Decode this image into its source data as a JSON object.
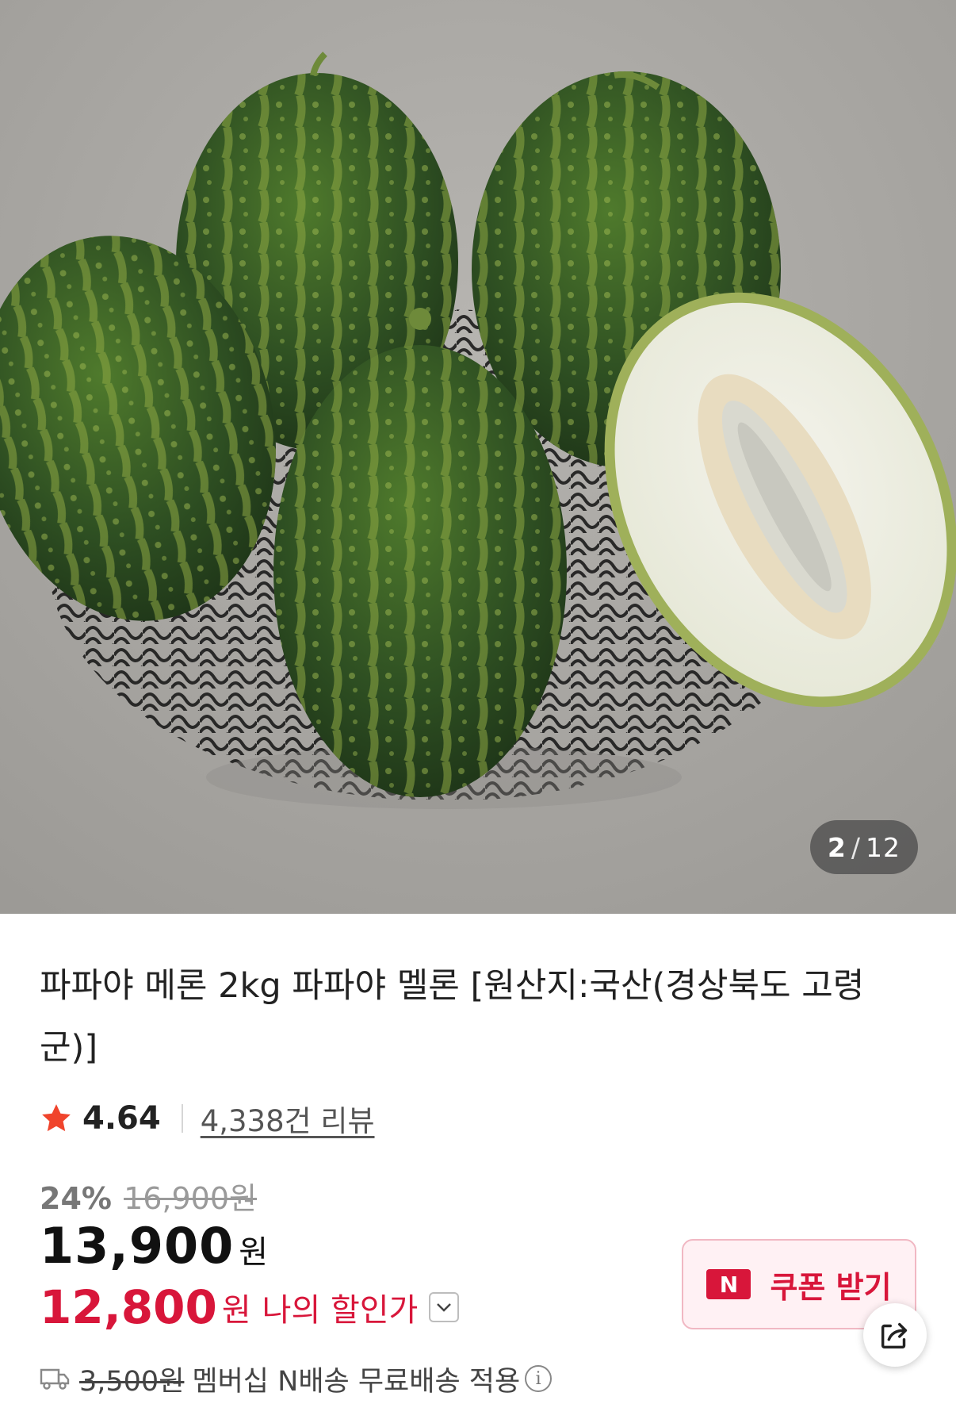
{
  "gallery": {
    "current": "2",
    "separator": "/",
    "total": "12",
    "image_alt": "파파야 메론 사진"
  },
  "product": {
    "title": "파파야 메론 2kg 파파야 멜론 [원산지:국산(경상북도 고령군)]"
  },
  "rating": {
    "score": "4.64",
    "reviews_label": "4,338건 리뷰",
    "star_color": "#f0442c"
  },
  "price": {
    "discount_percent": "24%",
    "original_price": "16,900원",
    "sale_price": "13,900",
    "sale_unit": "원",
    "my_price": "12,800",
    "my_unit": "원",
    "my_label": "나의 할인가",
    "accent_color": "#d8163a"
  },
  "coupon": {
    "badge": "N",
    "label": "쿠폰 받기"
  },
  "shipping": {
    "original_fee": "3,500원",
    "label": "멤버십 N배송 무료배송 적용",
    "info_symbol": "i"
  },
  "icons": {
    "star": "star-icon",
    "chevron": "chevron-down-icon",
    "share": "share-icon",
    "truck": "truck-icon",
    "info": "info-icon"
  }
}
